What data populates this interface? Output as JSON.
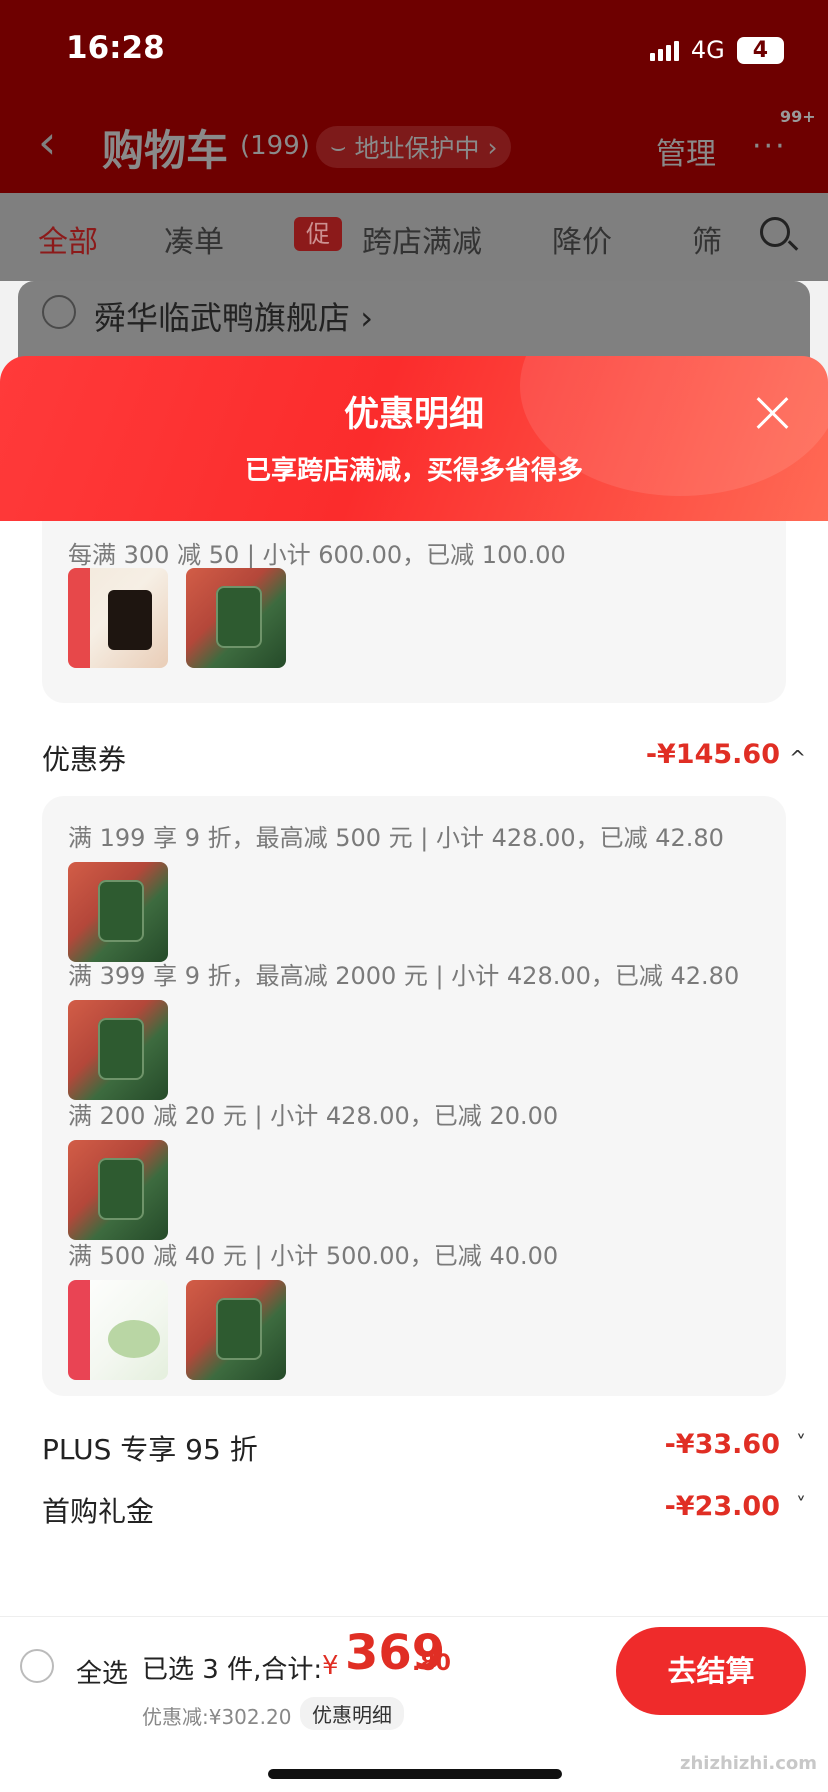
{
  "status_bar": {
    "time": "16:28",
    "network": "4G",
    "battery": "4"
  },
  "nav": {
    "back_icon": "chevron-left-icon",
    "title": "购物车",
    "count": "(199)",
    "address_protect": "地址保护中",
    "manage": "管理",
    "more": "···",
    "badge": "99+"
  },
  "filters": {
    "all": "全部",
    "combine": "凑单",
    "promo_tag": "促",
    "cross_store": "跨店满减",
    "price_drop": "降价",
    "filter": "筛"
  },
  "store": {
    "name": "舜华临武鸭旗舰店",
    "arrow": "›"
  },
  "sheet": {
    "title": "优惠明细",
    "subtitle": "已享跨店满减，买得多省得多",
    "cross_store_rule": "每满 300 减 50 | 小计 600.00，已减 100.00",
    "coupon_label": "优惠券",
    "coupon_amount": "-¥145.60",
    "coupon_chevron": "^",
    "coupon_rules": [
      "满 199 享 9 折，最高减 500 元 | 小计 428.00，已减 42.80",
      "满 399 享 9 折，最高减 2000 元 | 小计 428.00，已减 42.80",
      "满 200 减 20 元 | 小计 428.00，已减 20.00",
      "满 500 减 40 元 | 小计 500.00，已减 40.00"
    ],
    "plus_label": "PLUS 专享 95 折",
    "plus_amount": "-¥33.60",
    "first_label": "首购礼金",
    "first_amount": "-¥23.00",
    "collapse_chevron": "˅"
  },
  "bottom": {
    "select_all": "全选",
    "selected_text": "已选 3 件,合计:",
    "price_symbol": "¥",
    "price_int": "369",
    "price_dec": ".80",
    "discount": "优惠减:¥302.20",
    "detail_chip": "优惠明细",
    "checkout": "去结算",
    "watermark": "zhizhizhi.com"
  },
  "colors": {
    "accent": "#e02e24",
    "header_red": "#fb2c2c",
    "dim_red": "#6e0000"
  }
}
